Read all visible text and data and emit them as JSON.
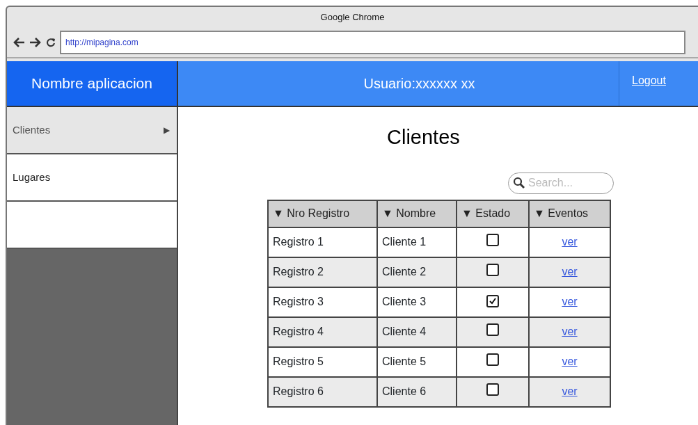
{
  "window": {
    "title": "Google Chrome"
  },
  "address_bar": {
    "url": "http://mipagina.com"
  },
  "header": {
    "app_name": "Nombre aplicacion",
    "user": "Usuario:xxxxxx xx",
    "logout": "Logout"
  },
  "sidebar": {
    "items": [
      {
        "label": "Clientes",
        "selected": true,
        "arrow": "▶"
      },
      {
        "label": "Lugares",
        "selected": false
      }
    ]
  },
  "page_title": "Clientes",
  "search": {
    "placeholder": "Search..."
  },
  "table": {
    "columns": [
      {
        "label": "Nro Registro",
        "sort": "▼"
      },
      {
        "label": "Nombre",
        "sort": "▼"
      },
      {
        "label": "Estado",
        "sort": "▼"
      },
      {
        "label": "Eventos",
        "sort": "▼"
      }
    ],
    "rows": [
      {
        "registro": "Registro 1",
        "nombre": "Cliente 1",
        "checked": false,
        "link": "ver"
      },
      {
        "registro": "Registro 2",
        "nombre": "Cliente 2",
        "checked": false,
        "link": "ver"
      },
      {
        "registro": "Registro 3",
        "nombre": "Cliente 3",
        "checked": true,
        "link": "ver"
      },
      {
        "registro": "Registro 4",
        "nombre": "Cliente 4",
        "checked": false,
        "link": "ver"
      },
      {
        "registro": "Registro 5",
        "nombre": "Cliente 5",
        "checked": false,
        "link": "ver"
      },
      {
        "registro": "Registro 6",
        "nombre": "Cliente 6",
        "checked": false,
        "link": "ver"
      }
    ]
  }
}
